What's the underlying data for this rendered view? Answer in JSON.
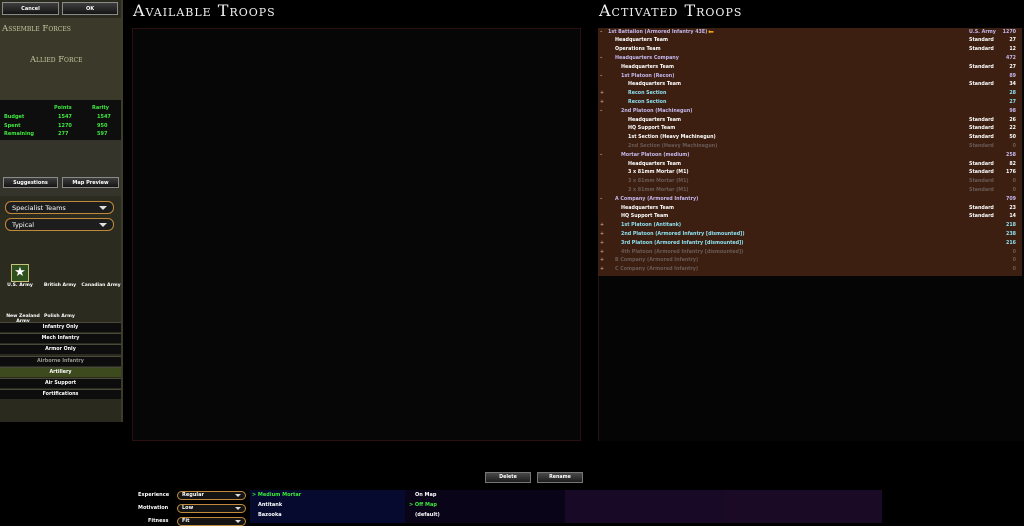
{
  "top_buttons": {
    "cancel": "Cancel",
    "ok": "OK"
  },
  "header": {
    "assemble": "Assemble Forces",
    "force": "Allied Force"
  },
  "budget": {
    "col_points": "Points",
    "col_rarity": "Rarity",
    "rows": [
      {
        "label": "Budget",
        "points": "1547",
        "rarity": "1547"
      },
      {
        "label": "Spent",
        "points": "1270",
        "rarity": "950"
      },
      {
        "label": "Remaining",
        "points": "277",
        "rarity": "597"
      }
    ]
  },
  "tools": {
    "suggestions": "Suggestions",
    "map_preview": "Map Preview"
  },
  "filters": {
    "category": "Specialist Teams",
    "quality": "Typical"
  },
  "nations": [
    "U.S. Army",
    "British Army",
    "Canadian Army",
    "New Zealand Army",
    "Polish Army"
  ],
  "categories": [
    {
      "label": "Infantry Only",
      "state": "normal"
    },
    {
      "label": "Mech Infantry",
      "state": "normal"
    },
    {
      "label": "Armor Only",
      "state": "normal"
    },
    {
      "label": "Airborne Infantry",
      "state": "dim"
    },
    {
      "label": "Artillery",
      "state": "selected"
    },
    {
      "label": "Air Support",
      "state": "normal"
    },
    {
      "label": "Fortifications",
      "state": "normal"
    }
  ],
  "titles": {
    "available": "Available Troops",
    "activated": "Activated Troops"
  },
  "activated": [
    {
      "ind": "–",
      "name": "1st Battalion (Armored Infantry 43E)",
      "type": "U.S. Army",
      "pts": "1270",
      "level": 0,
      "color": "lav",
      "arrow": true
    },
    {
      "ind": "",
      "name": "Headquarters Team",
      "type": "Standard",
      "pts": "27",
      "level": 1,
      "color": "white"
    },
    {
      "ind": "",
      "name": "Operations Team",
      "type": "Standard",
      "pts": "12",
      "level": 1,
      "color": "white"
    },
    {
      "ind": "–",
      "name": "Headquarters Company",
      "type": "",
      "pts": "472",
      "level": 1,
      "color": "lav"
    },
    {
      "ind": "",
      "name": "Headquarters Team",
      "type": "Standard",
      "pts": "27",
      "level": 2,
      "color": "white"
    },
    {
      "ind": "–",
      "name": "1st Platoon (Recon)",
      "type": "",
      "pts": "89",
      "level": 2,
      "color": "lav"
    },
    {
      "ind": "",
      "name": "Headquarters Team",
      "type": "Standard",
      "pts": "34",
      "level": 3,
      "color": "white"
    },
    {
      "ind": "+",
      "name": "Recon Section",
      "type": "",
      "pts": "28",
      "level": 3,
      "color": "cyan"
    },
    {
      "ind": "+",
      "name": "Recon Section",
      "type": "",
      "pts": "27",
      "level": 3,
      "color": "cyan"
    },
    {
      "ind": "–",
      "name": "2nd Platoon (Machinegun)",
      "type": "",
      "pts": "98",
      "level": 2,
      "color": "lav"
    },
    {
      "ind": "",
      "name": "Headquarters Team",
      "type": "Standard",
      "pts": "26",
      "level": 3,
      "color": "white"
    },
    {
      "ind": "",
      "name": "HQ Support Team",
      "type": "Standard",
      "pts": "22",
      "level": 3,
      "color": "white"
    },
    {
      "ind": "",
      "name": "1st Section (Heavy Machinegun)",
      "type": "Standard",
      "pts": "50",
      "level": 3,
      "color": "white"
    },
    {
      "ind": "",
      "name": "2nd Section (Heavy Machinegun)",
      "type": "Standard",
      "pts": "0",
      "level": 3,
      "color": "dim"
    },
    {
      "ind": "–",
      "name": "Mortar Platoon (medium)",
      "type": "",
      "pts": "258",
      "level": 2,
      "color": "lav"
    },
    {
      "ind": "",
      "name": "Headquarters Team",
      "type": "Standard",
      "pts": "82",
      "level": 3,
      "color": "white"
    },
    {
      "ind": "",
      "name": "3 x 81mm Mortar (M1)",
      "type": "Standard",
      "pts": "176",
      "level": 3,
      "color": "white"
    },
    {
      "ind": "",
      "name": "3 x 81mm Mortar (M1)",
      "type": "Standard",
      "pts": "0",
      "level": 3,
      "color": "dim"
    },
    {
      "ind": "",
      "name": "3 x 81mm Mortar (M1)",
      "type": "Standard",
      "pts": "0",
      "level": 3,
      "color": "dim"
    },
    {
      "ind": "–",
      "name": "A Company (Armored Infantry)",
      "type": "",
      "pts": "709",
      "level": 1,
      "color": "lav"
    },
    {
      "ind": "",
      "name": "Headquarters Team",
      "type": "Standard",
      "pts": "23",
      "level": 2,
      "color": "white"
    },
    {
      "ind": "",
      "name": "HQ Support Team",
      "type": "Standard",
      "pts": "14",
      "level": 2,
      "color": "white"
    },
    {
      "ind": "+",
      "name": "1st Platoon (Antitank)",
      "type": "",
      "pts": "218",
      "level": 2,
      "color": "cyan"
    },
    {
      "ind": "+",
      "name": "2nd Platoon (Armored Infantry [dismounted])",
      "type": "",
      "pts": "238",
      "level": 2,
      "color": "cyan"
    },
    {
      "ind": "+",
      "name": "3rd Platoon (Armored Infantry [dismounted])",
      "type": "",
      "pts": "216",
      "level": 2,
      "color": "cyan"
    },
    {
      "ind": "+",
      "name": "4th Platoon (Armored Infantry [dismounted])",
      "type": "",
      "pts": "0",
      "level": 2,
      "color": "dim"
    },
    {
      "ind": "+",
      "name": "B Company (Armored Infantry)",
      "type": "",
      "pts": "0",
      "level": 1,
      "color": "dim"
    },
    {
      "ind": "+",
      "name": "C Company (Armored Infantry)",
      "type": "",
      "pts": "0",
      "level": 1,
      "color": "dim"
    }
  ],
  "actions": {
    "delete": "Delete",
    "rename": "Rename"
  },
  "bottom": {
    "experience_label": "Experience",
    "experience_value": "Regular",
    "motivation_label": "Motivation",
    "motivation_value": "Low",
    "fitness_label": "Fitness",
    "fitness_value": "Fit",
    "units": [
      "> Medium Mortar",
      "Antitank",
      "Bazooka"
    ],
    "deploy": [
      "On Map",
      "> Off Map",
      "(default)"
    ]
  }
}
